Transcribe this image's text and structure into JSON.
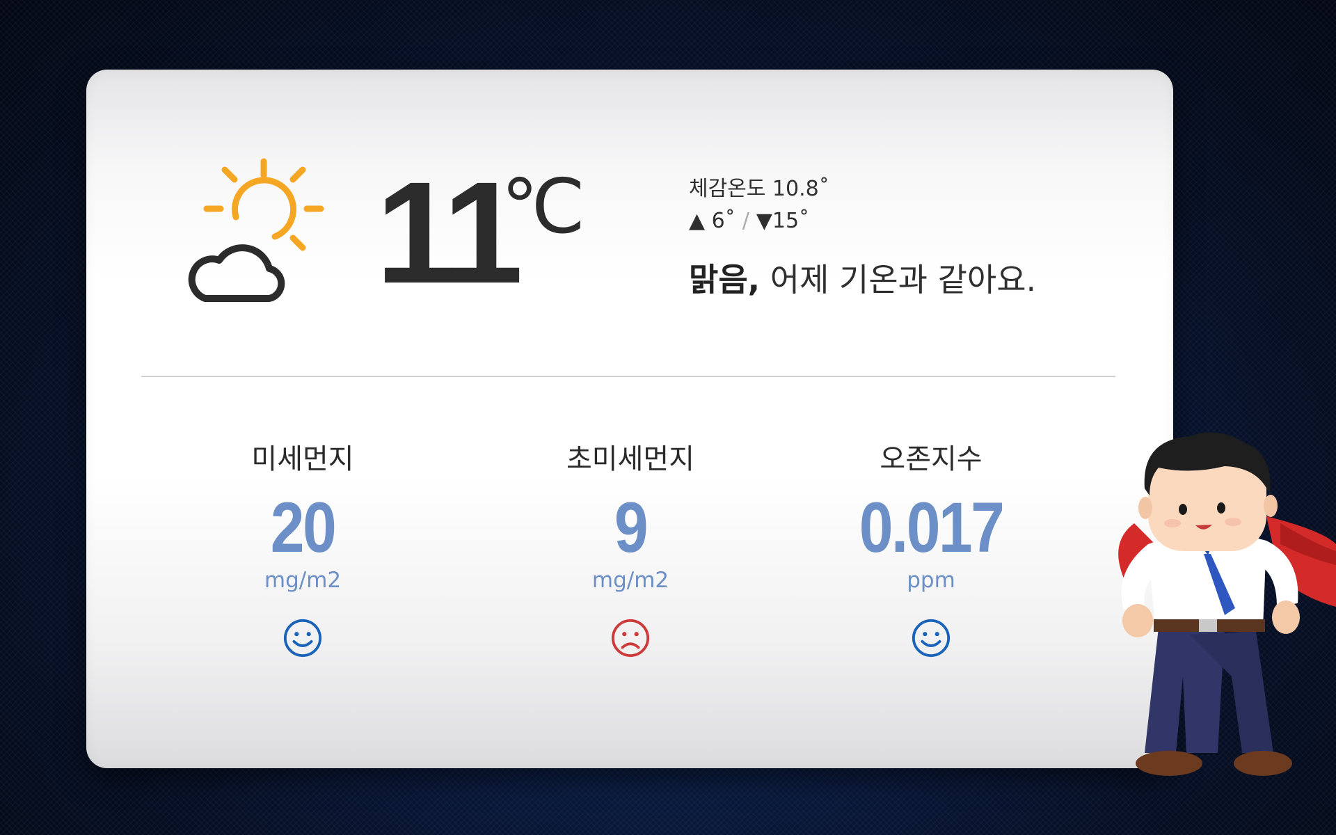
{
  "weather": {
    "icon": "partly-cloudy-sun-icon",
    "temperature": "11",
    "unit": "℃",
    "feels_like": "체감온도 10.8˚",
    "low": "▲ 6˚",
    "high": "▼15˚",
    "separator": "/",
    "summary_strong": "맑음,",
    "summary_rest": " 어제 기온과 같아요."
  },
  "metrics": [
    {
      "title": "미세먼지",
      "value": "20",
      "unit": "mg/m2",
      "face": "smile-face-icon",
      "color": "#1a63b8"
    },
    {
      "title": "초미세먼지",
      "value": "9",
      "unit": "mg/m2",
      "face": "sad-face-icon",
      "color": "#cc3a3a"
    },
    {
      "title": "오존지수",
      "value": "0.017",
      "unit": "ppm",
      "face": "smile-face-icon",
      "color": "#1a63b8"
    }
  ],
  "colors": {
    "accent_value": "#6b8fc6",
    "sun": "#f5a623",
    "dark_text": "#2c2c2c",
    "background": "#0a1d44"
  },
  "mascot": {
    "icon": "businessman-mascot-icon"
  }
}
